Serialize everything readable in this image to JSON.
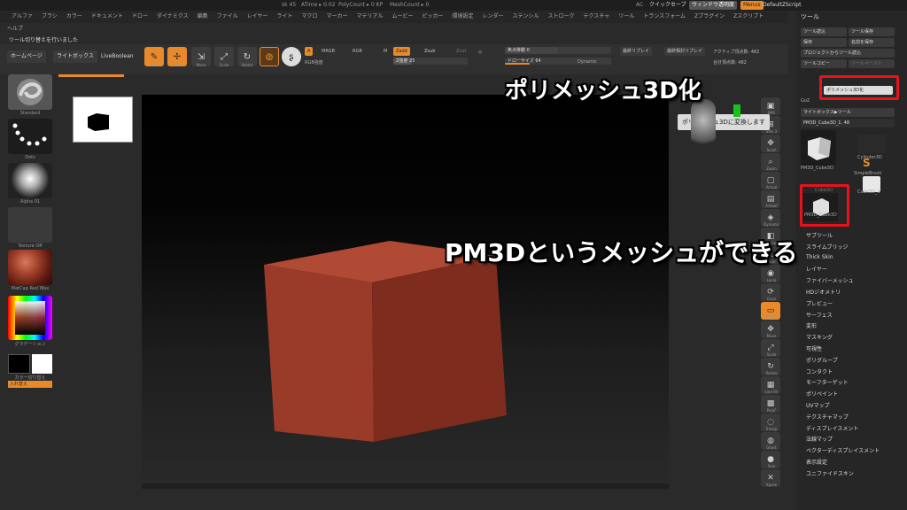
{
  "status": {
    "item1": "sk 45",
    "atime": "ATime ▸ 0.02",
    "polycount": "PolyCount ▸ 0 KP",
    "meshcount": "MeshCount ▸ 0",
    "ac": "AC",
    "quicksave": "クイックセーブ",
    "window_transparency": "ウィンドウ透明度",
    "menus": "Menus",
    "default_script": "DefaultZScript"
  },
  "menubar": [
    "アルファ",
    "ブラシ",
    "カラー",
    "ドキュメント",
    "ドロー",
    "ダイナミクス",
    "編集",
    "ファイル",
    "レイヤー",
    "ライト",
    "マクロ",
    "マーカー",
    "マテリアル",
    "ムービー",
    "ピッカー",
    "環境設定",
    "レンダー",
    "ステンシル",
    "ストローク",
    "テクスチャ",
    "ツール",
    "トランスフォーム",
    "Zプラグイン",
    "Zスクリプト"
  ],
  "help_label": "ヘルプ",
  "notice": "ツール切り替えを行いました",
  "shelf": {
    "tabs": [
      "ホームページ",
      "ライトボックス",
      "LiveBoolean"
    ],
    "edit": "Edit",
    "draw": "Draw",
    "move": "Move",
    "scale": "Scale",
    "rotate": "Rotate",
    "a_label": "A",
    "mrgb": "MRGB",
    "rgb": "RGB",
    "m": "M",
    "zadd": "Zadd",
    "zsub": "Zsub",
    "zcut": "Zcut",
    "rgb_intensity": "RGB強度",
    "z_intensity": "Z強度 25",
    "focal_shift": "焦点移動 0",
    "draw_size": "ドローサイズ 64",
    "dynamic": "Dynamic",
    "replay_last": "最終リプレイ",
    "replay_last_rel": "最終相対リプレイ",
    "active_points": "アクティブ頂点数: 482",
    "total_points": "合計頂点数: 482"
  },
  "left_panel": [
    {
      "caption": "Standard"
    },
    {
      "caption": "Dots"
    },
    {
      "caption": "Alpha 01"
    },
    {
      "caption": "Texture Off"
    },
    {
      "caption": "MatCap Red Wax"
    },
    {
      "caption": "グラデーション"
    },
    {
      "caption": "カラー切り替え"
    },
    {
      "caption": "入れ替え"
    }
  ],
  "right_shelf": [
    "BPR",
    "SPix 3",
    "Scroll",
    "Zoom",
    "Actual",
    "AAHalf",
    "Dynamic",
    "Persp",
    "Floor",
    "Local",
    "Gxyz",
    "Frame",
    "Move",
    "Scale",
    "Rotate",
    "Line Fill",
    "PolyF",
    "Transp",
    "Ghost",
    "Solo",
    "Xpose"
  ],
  "panel": {
    "title": "ツール",
    "load_tool": "ツール読込",
    "save_tool": "ツール保存",
    "save": "保存",
    "save_as": "名前を保存",
    "load_from_project": "プロジェクトからツール読込",
    "copy_tool": "ツールコピー",
    "paste_tool": "ツールペースト",
    "make_polymesh": "ポリメッシュ3D化",
    "goz": "GoZ",
    "lightbox_tools": "ライトボックス▶ツール",
    "current_tool": "PM3D_Cube3D_1. 48",
    "thumbs": [
      {
        "label": "PM3D_Cube3D"
      },
      {
        "label": "Cylinder3D"
      },
      {
        "label": "SimpleBrush"
      },
      {
        "label": "Cube3D"
      },
      {
        "label": "PM3D_Cube3D"
      },
      {
        "label": "Cube3D_1"
      }
    ],
    "subpalettes": [
      "サブツール",
      "スライムブリッジ",
      "Thick Skin",
      "レイヤー",
      "ファイバーメッシュ",
      "HDジオメトリ",
      "プレビュー",
      "サーフェス",
      "変形",
      "マスキング",
      "可視性",
      "ポリグループ",
      "コンタクト",
      "モーフターゲット",
      "ポリペイント",
      "UVマップ",
      "テクスチャマップ",
      "ディスプレイスメント",
      "法線マップ",
      "ベクターディスプレイスメント",
      "表示設定",
      "ユニファイドスキン"
    ]
  },
  "tooltip": "ポリメッシュ3Dに変換します",
  "captions": {
    "top": "ポリメッシュ3D化",
    "middle": "PM3Dというメッシュができる"
  },
  "colors": {
    "accent": "#e88a2c",
    "highlight": "#e8121e",
    "cube_front": "#9a3b2a",
    "cube_side": "#7e2c1e"
  }
}
